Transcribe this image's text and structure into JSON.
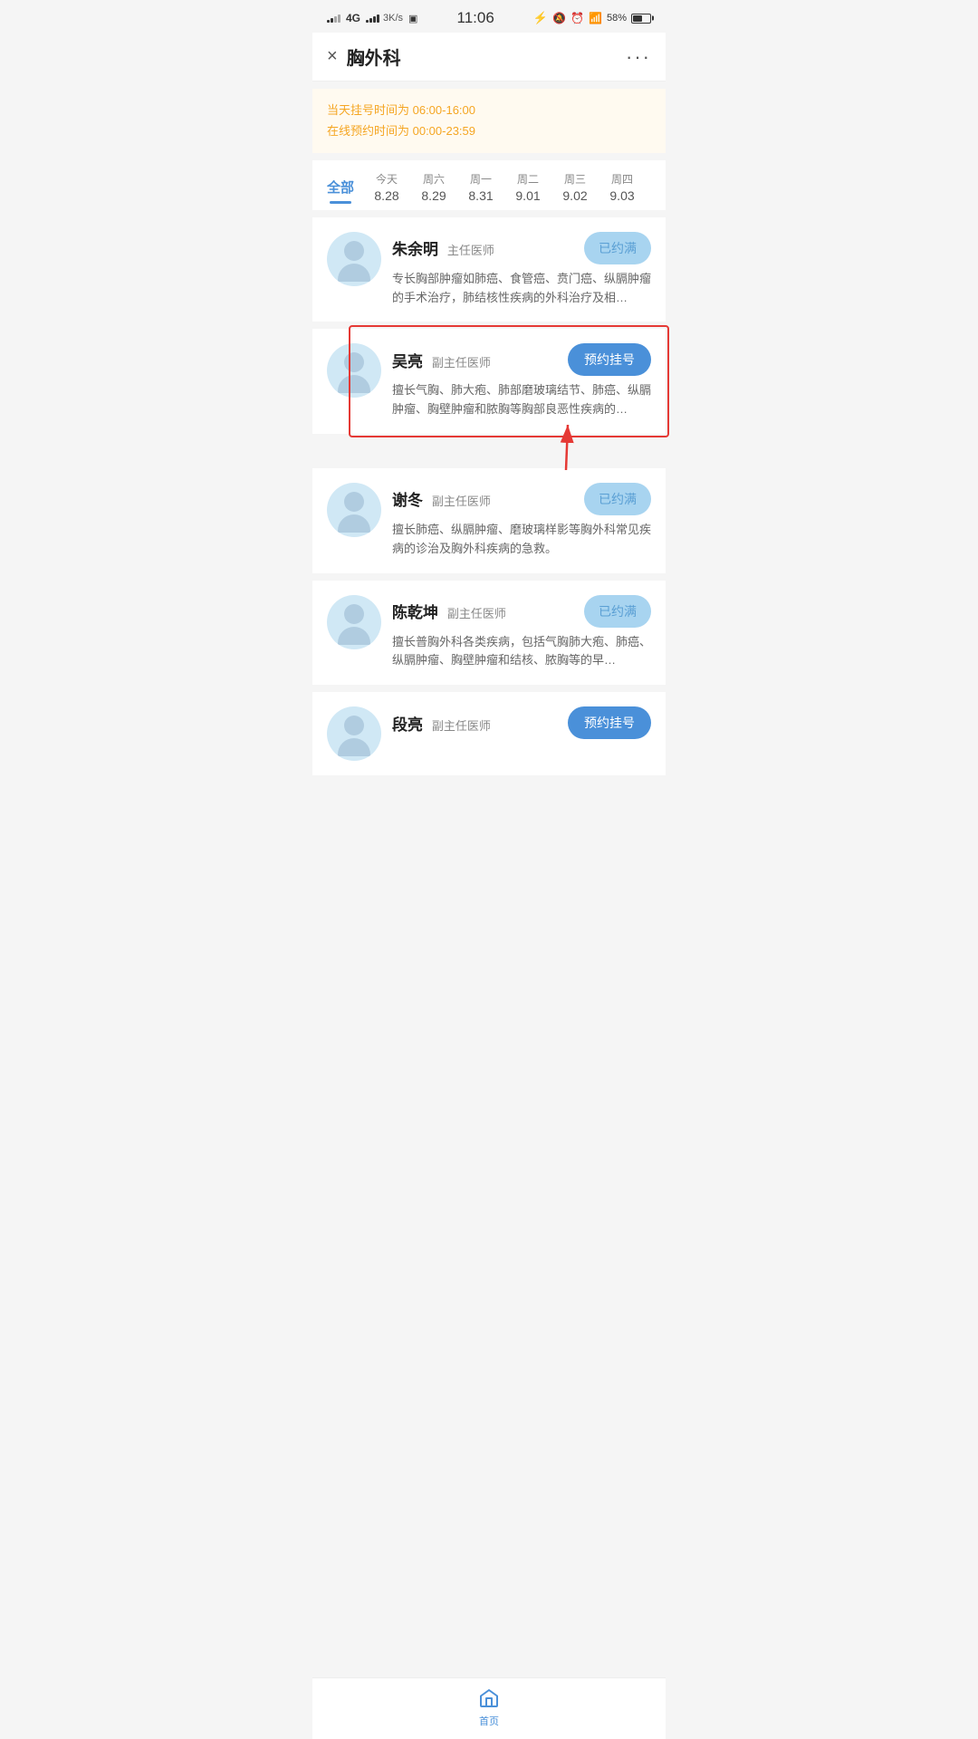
{
  "statusBar": {
    "time": "11:06",
    "network": "4G",
    "speed": "3K/s",
    "battery": "58%"
  },
  "header": {
    "closeLabel": "×",
    "title": "胸外科",
    "moreLabel": "···"
  },
  "notice": {
    "line1": "当天挂号时间为 06:00-16:00",
    "line2": "在线预约时间为 00:00-23:59"
  },
  "tabs": [
    {
      "week": "全部",
      "date": "",
      "active": true
    },
    {
      "week": "今天",
      "date": "8.28",
      "active": false
    },
    {
      "week": "周六",
      "date": "8.29",
      "active": false
    },
    {
      "week": "周一",
      "date": "8.31",
      "active": false
    },
    {
      "week": "周二",
      "date": "9.01",
      "active": false
    },
    {
      "week": "周三",
      "date": "9.02",
      "active": false
    },
    {
      "week": "周四",
      "date": "9.03",
      "active": false
    }
  ],
  "doctors": [
    {
      "id": "zhu-yuming",
      "name": "朱余明",
      "title": "主任医师",
      "desc": "专长胸部肿瘤如肺癌、食管癌、贲门癌、纵膈肿瘤的手术治疗，肺结核性疾病的外科治疗及相…",
      "btnType": "full",
      "btnLabel": "已约满",
      "highlight": false
    },
    {
      "id": "wu-liang",
      "name": "吴亮",
      "title": "副主任医师",
      "desc": "擅长气胸、肺大疱、肺部磨玻璃结节、肺癌、纵膈肿瘤、胸壁肿瘤和脓胸等胸部良恶性疾病的…",
      "btnType": "available",
      "btnLabel": "预约挂号",
      "highlight": true
    },
    {
      "id": "xie-dong",
      "name": "谢冬",
      "title": "副主任医师",
      "desc": "擅长肺癌、纵膈肿瘤、磨玻璃样影等胸外科常见疾病的诊治及胸外科疾病的急救。",
      "btnType": "full",
      "btnLabel": "已约满",
      "highlight": false
    },
    {
      "id": "chen-qiankun",
      "name": "陈乾坤",
      "title": "副主任医师",
      "desc": "擅长普胸外科各类疾病，包括气胸肺大疱、肺癌、纵膈肿瘤、胸壁肿瘤和结核、脓胸等的早…",
      "btnType": "full",
      "btnLabel": "已约满",
      "highlight": false
    },
    {
      "id": "duan-liang",
      "name": "段亮",
      "title": "副主任医师",
      "desc": "",
      "btnType": "available",
      "btnLabel": "预约挂号",
      "highlight": false
    }
  ],
  "bottomNav": {
    "items": [
      {
        "label": "首页",
        "icon": "home-icon"
      }
    ]
  }
}
